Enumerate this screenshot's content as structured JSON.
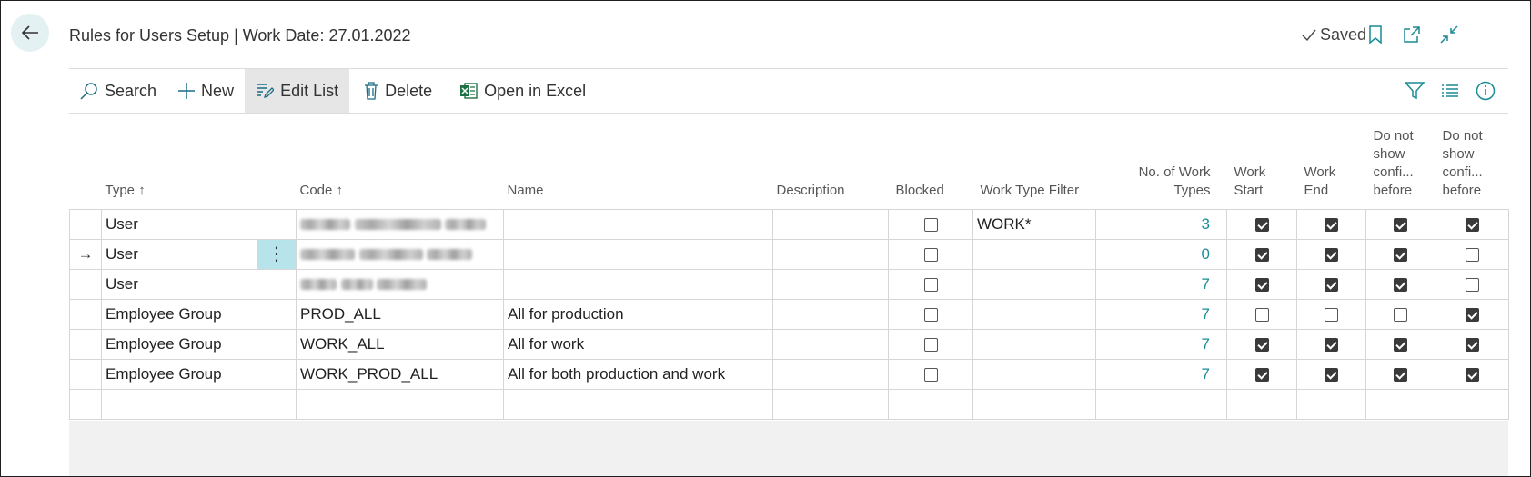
{
  "header": {
    "title": "Rules for Users Setup | Work Date: 27.01.2022",
    "saved_label": "Saved",
    "icons": [
      "back-arrow-icon",
      "checkmark-icon",
      "bookmark-icon",
      "open-new-window-icon",
      "collapse-icon"
    ]
  },
  "actions": {
    "search": "Search",
    "new": "New",
    "edit_list": "Edit List",
    "delete": "Delete",
    "open_in_excel": "Open in Excel",
    "right_icons": [
      "filter-icon",
      "list-view-icon",
      "info-icon"
    ]
  },
  "table": {
    "columns": {
      "type": "Type",
      "type_sort": "↑",
      "code": "Code",
      "code_sort": "↑",
      "name": "Name",
      "description": "Description",
      "blocked": "Blocked",
      "work_type_filter": "Work Type Filter",
      "no_of_work_types_1": "No. of Work",
      "no_of_work_types_2": "Types",
      "work_start_1": "Work",
      "work_start_2": "Start",
      "work_end_1": "Work",
      "work_end_2": "End",
      "dns1_1": "Do not",
      "dns1_2": "show",
      "dns1_3": "confi...",
      "dns1_4": "before",
      "dns2_1": "Do not",
      "dns2_2": "show",
      "dns2_3": "confi...",
      "dns2_4": "before"
    },
    "rows": [
      {
        "type": "User",
        "code": "",
        "code_redacted": true,
        "name": "",
        "description": "",
        "blocked": false,
        "work_type_filter": "WORK*",
        "no_of_work_types": "3",
        "work_start": true,
        "work_end": true,
        "dns1": true,
        "dns2": true
      },
      {
        "type": "User",
        "code": "",
        "code_redacted": true,
        "name": "",
        "description": "",
        "blocked": false,
        "work_type_filter": "",
        "no_of_work_types": "0",
        "work_start": true,
        "work_end": true,
        "dns1": true,
        "dns2": false
      },
      {
        "type": "User",
        "code": "",
        "code_redacted": true,
        "name": "",
        "description": "",
        "blocked": false,
        "work_type_filter": "",
        "no_of_work_types": "7",
        "work_start": true,
        "work_end": true,
        "dns1": true,
        "dns2": false
      },
      {
        "type": "Employee Group",
        "code": "PROD_ALL",
        "name": "All for production",
        "description": "",
        "blocked": false,
        "work_type_filter": "",
        "no_of_work_types": "7",
        "work_start": false,
        "work_end": false,
        "dns1": false,
        "dns2": true
      },
      {
        "type": "Employee Group",
        "code": "WORK_ALL",
        "name": "All for work",
        "description": "",
        "blocked": false,
        "work_type_filter": "",
        "no_of_work_types": "7",
        "work_start": true,
        "work_end": true,
        "dns1": true,
        "dns2": true
      },
      {
        "type": "Employee Group",
        "code": "WORK_PROD_ALL",
        "name": "All for both production and work",
        "description": "",
        "blocked": false,
        "work_type_filter": "",
        "no_of_work_types": "7",
        "work_start": true,
        "work_end": true,
        "dns1": true,
        "dns2": true
      }
    ],
    "current_row_arrow": "→",
    "row_menu_glyph": "⋮"
  },
  "colors": {
    "accent": "#1a8c95",
    "back_button_bg": "#e3f1f2",
    "active_action_bg": "#e6e6e6",
    "row_menu_bg": "#b6e4ea",
    "excel_green": "#1e7145"
  }
}
